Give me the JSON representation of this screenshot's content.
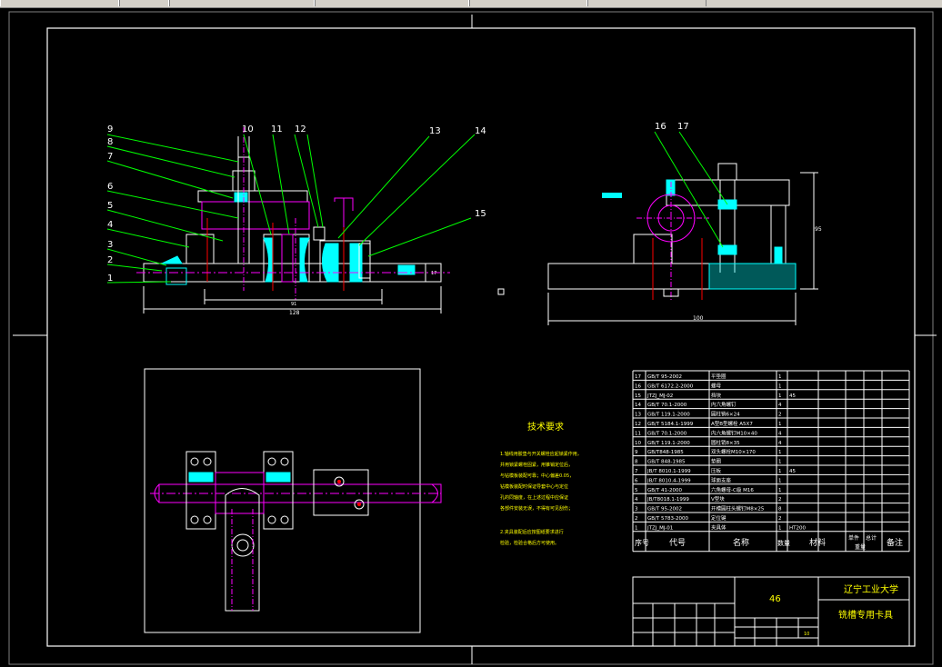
{
  "colors": {
    "background": "#000000",
    "line": "#ffffff",
    "leader": "#00ff00",
    "center": "#ff00ff",
    "section": "#00ffff",
    "hidden": "#ff0000",
    "text_yellow": "#ffff00"
  },
  "balloons": {
    "front": [
      "9",
      "8",
      "7",
      "6",
      "5",
      "4",
      "3",
      "2",
      "1",
      "10",
      "11",
      "12",
      "13",
      "14",
      "15"
    ],
    "side": [
      "16",
      "17"
    ]
  },
  "tech_requirements": {
    "title": "技术要求",
    "lines": [
      "1.轴线用胶垫与开关螺栓应起锁紧作用，",
      "并用锁紧螺栓固紧，用锥销定位后，",
      "与钻模板装配可靠；中心偏差0.05，",
      "钻模板装配时保证导套中心与定位",
      "孔的同轴度，在上述过程中应保证",
      "各部件安装无误，不得有可见刮伤；",
      "2.夹具装配后应按图纸要求进行",
      "检验，检验合格后方可使用。"
    ]
  },
  "bom": {
    "rows": [
      {
        "no": "17",
        "code": "GB/T 95-2002",
        "name": "平垫圈",
        "qty": "1",
        "material": ""
      },
      {
        "no": "16",
        "code": "GB/T 6172.2-2000",
        "name": "螺母",
        "qty": "1",
        "material": ""
      },
      {
        "no": "15",
        "code": "JTZJ_MJ-02",
        "name": "挡块",
        "qty": "1",
        "material": "45"
      },
      {
        "no": "14",
        "code": "GB/T 70.1-2000",
        "name": "内六角螺钉",
        "qty": "4",
        "material": ""
      },
      {
        "no": "13",
        "code": "GB/T 119.1-2000",
        "name": "圆柱销6×24",
        "qty": "2",
        "material": ""
      },
      {
        "no": "12",
        "code": "GB/T 5184.1-1999",
        "name": "A型B型螺栓 A5X7",
        "qty": "1",
        "material": ""
      },
      {
        "no": "11",
        "code": "GB/T 70.1-2000",
        "name": "内六角螺钉M10×40",
        "qty": "4",
        "material": ""
      },
      {
        "no": "10",
        "code": "GB/T 119.1-2000",
        "name": "圆柱销8×35",
        "qty": "4",
        "material": ""
      },
      {
        "no": "9",
        "code": "GB/T848-1985",
        "name": "双头螺栓M10×170",
        "qty": "1",
        "material": ""
      },
      {
        "no": "8",
        "code": "GB/T 848-1985",
        "name": "垫圈",
        "qty": "1",
        "material": ""
      },
      {
        "no": "7",
        "code": "JB/T 8010.1-1999",
        "name": "压板",
        "qty": "1",
        "material": "45"
      },
      {
        "no": "6",
        "code": "JB/T 8010.4-1999",
        "name": "球面支座",
        "qty": "1",
        "material": ""
      },
      {
        "no": "5",
        "code": "GB/T 41-2000",
        "name": "六角螺母-C级 M16",
        "qty": "1",
        "material": ""
      },
      {
        "no": "4",
        "code": "JB/T8018.1-1999",
        "name": "V型块",
        "qty": "2",
        "material": ""
      },
      {
        "no": "3",
        "code": "GB/T 95-2002",
        "name": "开槽圆柱头螺钉M8×25",
        "qty": "8",
        "material": ""
      },
      {
        "no": "2",
        "code": "GB/T 5783-2000",
        "name": "定位键",
        "qty": "2",
        "material": ""
      },
      {
        "no": "1",
        "code": "JTZJ_MJ-01",
        "name": "夹具体",
        "qty": "1",
        "material": "HT200"
      }
    ],
    "header": {
      "no": "序号",
      "code": "代号",
      "name": "名称",
      "qty": "数量",
      "material": "材料",
      "unit": "单件",
      "total": "总计",
      "weight": "重量",
      "remark": "备注"
    }
  },
  "title_block": {
    "drawing_no": "46",
    "school": "辽宁工业大学",
    "title": "铣槽专用卡具",
    "scale_value": "10"
  },
  "dims": {
    "front_width": "128",
    "front_inner": "91",
    "front_height": "17",
    "side_width": "100",
    "side_height": "95"
  }
}
